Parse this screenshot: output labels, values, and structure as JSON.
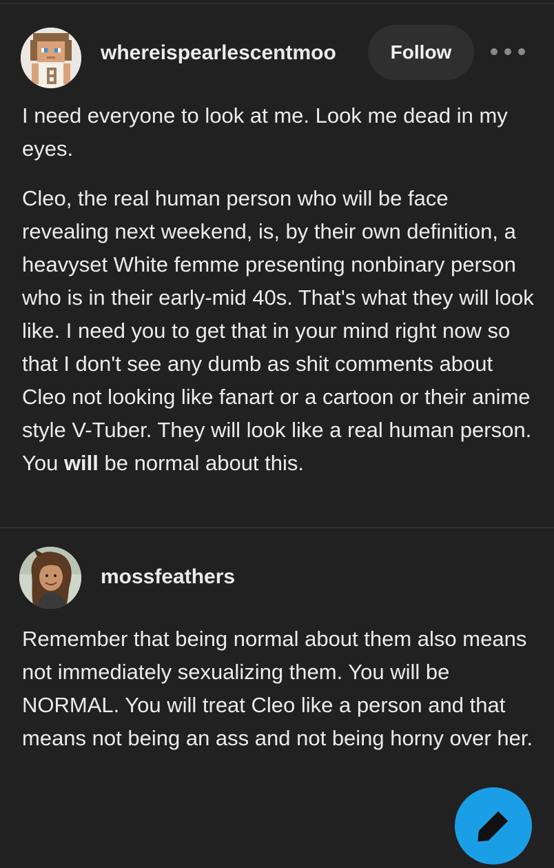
{
  "post": {
    "username": "whereispearlescentmoo",
    "follow_label": "Follow",
    "more_icon": "more-horizontal-icon",
    "paragraph1": "I need everyone to look at me. Look me dead in my eyes.",
    "paragraph2_text": "Cleo, the real human person who will be face revealing next weekend, is, by their own definition, a heavyset White femme presenting nonbinary person who is in their early-mid 40s. That's what they will look like. I need you to get that in your mind right now so that I don't see any dumb as shit comments about Cleo not looking like fanart or a cartoon or their anime style V-Tuber. They will look like a real human person. You",
    "paragraph2_bold": "will",
    "paragraph2_end": " be normal about this."
  },
  "reply": {
    "username": "mossfeathers",
    "text": "Remember that being normal about them also means not immediately sexualizing them. You will be NORMAL. You will treat Cleo like a person and that means not being an ass and not being horny over her."
  },
  "fab": {
    "icon": "pencil-icon"
  },
  "colors": {
    "background": "#212121",
    "text": "#ececec",
    "follow_button": "#2f2f2f",
    "fab": "#1a9fe6"
  }
}
